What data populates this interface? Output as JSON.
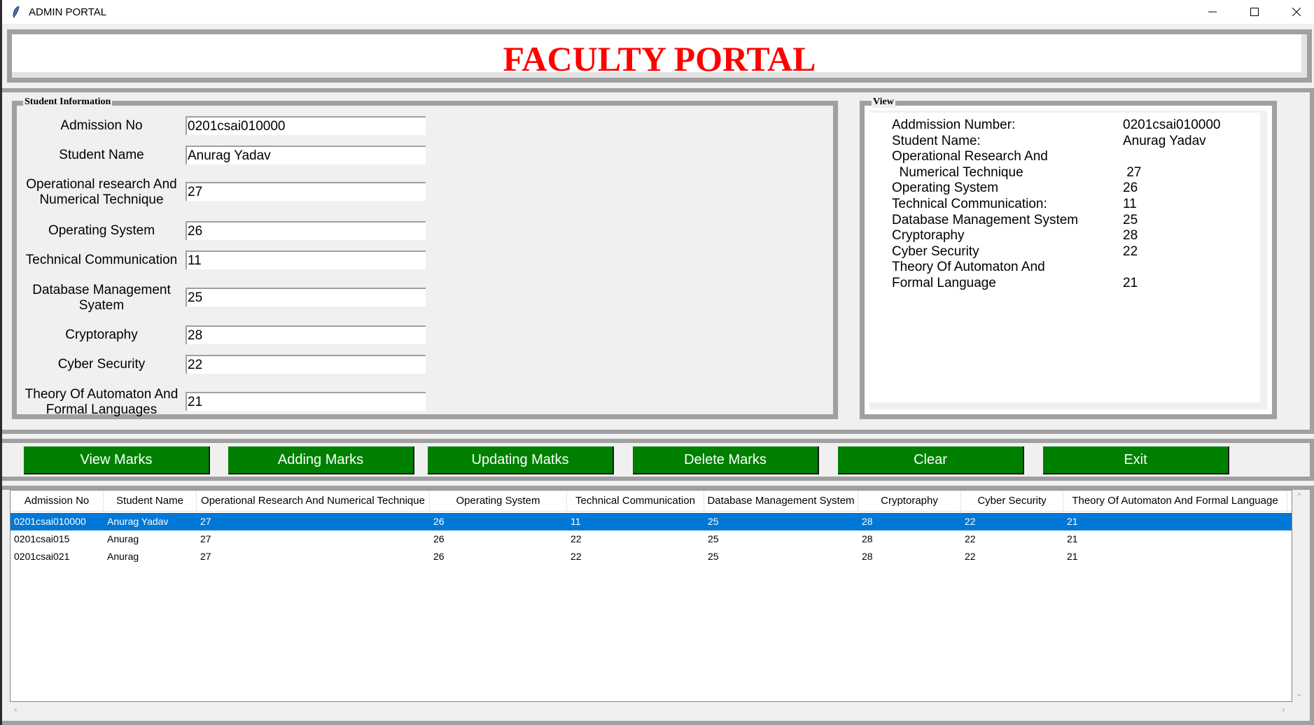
{
  "window": {
    "title": "ADMIN PORTAL",
    "icon": "feather-icon",
    "controls": [
      "minimize-icon",
      "maximize-icon",
      "close-icon"
    ]
  },
  "header": {
    "title": "FACULTY PORTAL",
    "title_color": "#ff0000"
  },
  "student_info": {
    "label": "Student Information",
    "fields": [
      {
        "label": "Admission No",
        "value": "0201csai010000"
      },
      {
        "label": "Student Name",
        "value": "Anurag Yadav"
      },
      {
        "label": "Operational research And Numerical Technique",
        "value": "27"
      },
      {
        "label": "Operating System",
        "value": "26"
      },
      {
        "label": "Technical Communication",
        "value": "11"
      },
      {
        "label": "Database Management Syatem",
        "value": "25"
      },
      {
        "label": "Cryptoraphy",
        "value": "28"
      },
      {
        "label": "Cyber Security",
        "value": "22"
      },
      {
        "label": "Theory Of Automaton And Formal Languages",
        "value": "21"
      }
    ]
  },
  "view": {
    "label": "View",
    "lines": [
      {
        "label": "Addmission Number:",
        "value": "0201csai010000"
      },
      {
        "label": "Student Name:",
        "value": "Anurag Yadav"
      },
      {
        "label": "Operational Research And",
        "value": ""
      },
      {
        "label": "  Numerical Technique",
        "value": " 27"
      },
      {
        "label": "Operating System",
        "value": "26"
      },
      {
        "label": "Technical Communication:",
        "value": "11"
      },
      {
        "label": "Database Management System",
        "value": "25"
      },
      {
        "label": "Cryptoraphy",
        "value": "28"
      },
      {
        "label": "Cyber Security",
        "value": "22"
      },
      {
        "label": "Theory Of Automaton And",
        "value": ""
      },
      {
        "label": "Formal Language",
        "value": "21"
      }
    ]
  },
  "buttons": {
    "color": "#008000",
    "items": [
      "View Marks",
      "Adding Marks",
      "Updating Matks",
      "Delete Marks",
      "Clear",
      "Exit"
    ]
  },
  "table": {
    "columns": [
      "Admission No",
      "Student Name",
      "Operational Research And Numerical Technique",
      "Operating System",
      "Technical Communication",
      "Database Management System",
      "Cryptoraphy",
      "Cyber Security",
      "Theory Of Automaton And Formal Language"
    ],
    "rows": [
      [
        "0201csai010000",
        "Anurag Yadav",
        "27",
        "26",
        "11",
        "25",
        "28",
        "22",
        "21"
      ],
      [
        "0201csai015",
        "Anurag",
        "27",
        "26",
        "22",
        "25",
        "28",
        "22",
        "21"
      ],
      [
        "0201csai021",
        "Anurag",
        "27",
        "26",
        "22",
        "25",
        "28",
        "22",
        "21"
      ]
    ],
    "selected_row": 0,
    "selection_color": "#0078d7"
  }
}
